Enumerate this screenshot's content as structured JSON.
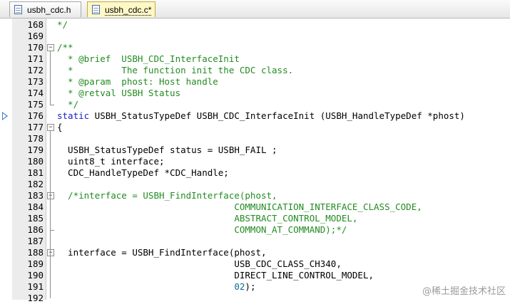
{
  "tabs": [
    {
      "label": "usbh_cdc.h",
      "active": false
    },
    {
      "label": "usbh_cdc.c*",
      "active": true
    }
  ],
  "lines": [
    {
      "num": "168",
      "segs": [
        {
          "t": "*/",
          "c": "comment"
        }
      ]
    },
    {
      "num": "169",
      "segs": []
    },
    {
      "num": "170",
      "fold": "minus",
      "segs": [
        {
          "t": "/**",
          "c": "comment"
        }
      ]
    },
    {
      "num": "171",
      "segs": [
        {
          "t": "  * @brief  USBH_CDC_InterfaceInit",
          "c": "comment"
        }
      ]
    },
    {
      "num": "172",
      "segs": [
        {
          "t": "  *         The function init the CDC class.",
          "c": "comment"
        }
      ]
    },
    {
      "num": "173",
      "segs": [
        {
          "t": "  * @param  phost: Host handle",
          "c": "comment"
        }
      ]
    },
    {
      "num": "174",
      "segs": [
        {
          "t": "  * @retval USBH Status",
          "c": "comment"
        }
      ]
    },
    {
      "num": "175",
      "segs": [
        {
          "t": "  */",
          "c": "comment"
        }
      ]
    },
    {
      "num": "176",
      "marker": true,
      "segs": [
        {
          "t": "static",
          "c": "keyword"
        },
        {
          "t": " USBH_StatusTypeDef USBH_CDC_InterfaceInit (USBH_HandleTypeDef *phost)",
          "c": "normal"
        }
      ]
    },
    {
      "num": "177",
      "fold": "minus",
      "segs": [
        {
          "t": "{",
          "c": "normal"
        }
      ]
    },
    {
      "num": "178",
      "segs": []
    },
    {
      "num": "179",
      "segs": [
        {
          "t": "  USBH_StatusTypeDef status = USBH_FAIL ;",
          "c": "normal"
        }
      ]
    },
    {
      "num": "180",
      "segs": [
        {
          "t": "  uint8_t interface;",
          "c": "normal"
        }
      ]
    },
    {
      "num": "181",
      "segs": [
        {
          "t": "  CDC_HandleTypeDef *CDC_Handle;",
          "c": "normal"
        }
      ]
    },
    {
      "num": "182",
      "segs": []
    },
    {
      "num": "183",
      "fold": "minus",
      "segs": [
        {
          "t": "  /*interface = USBH_FindInterface(phost,",
          "c": "comment"
        }
      ]
    },
    {
      "num": "184",
      "segs": [
        {
          "t": "                                 COMMUNICATION_INTERFACE_CLASS_CODE,",
          "c": "comment"
        }
      ]
    },
    {
      "num": "185",
      "segs": [
        {
          "t": "                                 ABSTRACT_CONTROL_MODEL,",
          "c": "comment"
        }
      ]
    },
    {
      "num": "186",
      "segs": [
        {
          "t": "                                 COMMON_AT_COMMAND);*/",
          "c": "comment"
        }
      ]
    },
    {
      "num": "187",
      "segs": []
    },
    {
      "num": "188",
      "fold": "minus",
      "segs": [
        {
          "t": "  interface = USBH_FindInterface(phost,",
          "c": "normal"
        }
      ]
    },
    {
      "num": "189",
      "segs": [
        {
          "t": "                                 USB_CDC_CLASS_CH340,",
          "c": "normal"
        }
      ]
    },
    {
      "num": "190",
      "segs": [
        {
          "t": "                                 DIRECT_LINE_CONTROL_MODEL,",
          "c": "normal"
        }
      ]
    },
    {
      "num": "191",
      "segs": [
        {
          "t": "                                 ",
          "c": "normal"
        },
        {
          "t": "02",
          "c": "number"
        },
        {
          "t": ");",
          "c": "normal"
        }
      ]
    },
    {
      "num": "192",
      "segs": []
    }
  ],
  "colors": {
    "comment": "#228b22",
    "keyword": "#1a1ac8",
    "normal": "#000000",
    "number": "#0b6e8f",
    "marker": "#3d7fc7",
    "gutter": "#ececec",
    "active_tab": "#fef7c6"
  },
  "icons": {
    "tab_file": "file-icon",
    "fold": "fold-toggle-icon",
    "current_line": "current-line-marker-icon"
  },
  "watermark": "@稀土掘金技术社区"
}
